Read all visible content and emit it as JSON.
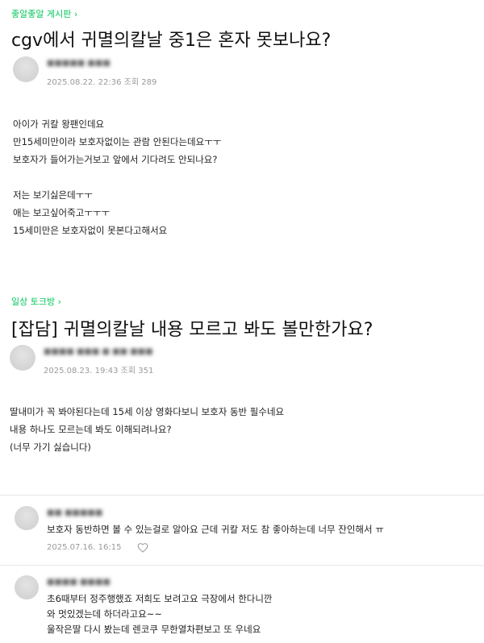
{
  "post1": {
    "board": "좋알좋알 게시판",
    "title": "cgv에서 귀멸의칼날 중1은 혼자 못보나요?",
    "author": "■■■■■ ■■■",
    "date": "2025.08.22. 22:36",
    "views_label": "조회",
    "views": "289",
    "body": [
      "아이가 귀칼 왕팬인데요",
      "만15세미만이라 보호자없이는 관람 안된다는데요ㅜㅜ",
      "보호자가 들어가는거보고 앞에서 기다려도 안되나요?",
      "",
      "저는 보기싫은데ㅜㅜ",
      "애는 보고싶어죽고ㅜㅜㅜ",
      "15세미만은 보호자없이 못본다고해서요"
    ]
  },
  "post2": {
    "board": "일상 토크방",
    "title": "[잡담] 귀멸의칼날 내용 모르고 봐도 볼만한가요?",
    "author": "■■■■ ■■■ ■ ■■ ■■■",
    "date": "2025.08.23. 19:43",
    "views_label": "조회",
    "views": "351",
    "body": [
      "딸내미가 꼭 봐야된다는데 15세 이상 영화다보니 보호자 동반 필수네요",
      "내용 하나도 모르는데 봐도 이해되려나요?",
      "(너무 가기 싫습니다)"
    ]
  },
  "comments": [
    {
      "author": "■■ ■■■■■",
      "text": [
        "보호자 동반하면 볼 수 있는걸로 알아요 근데 귀칼 저도 참 좋아하는데 너무 잔인해서 ㅠ"
      ],
      "date": "2025.07.16. 16:15",
      "icon": "heart-outline"
    },
    {
      "author": "■■■■ ■■■■",
      "text": [
        "초6때부터 정주행했죠 저희도 보려고요 극장에서 한다니깐",
        "와 멋있겠는데 하더라고요~~",
        "울작은딸 다시 봤는데 렌코쿠 무한열차편보고 또 우네요"
      ]
    }
  ],
  "colors": {
    "accent": "#03c75a",
    "meta": "#9a9a9a",
    "divider": "#e8e8e8"
  }
}
